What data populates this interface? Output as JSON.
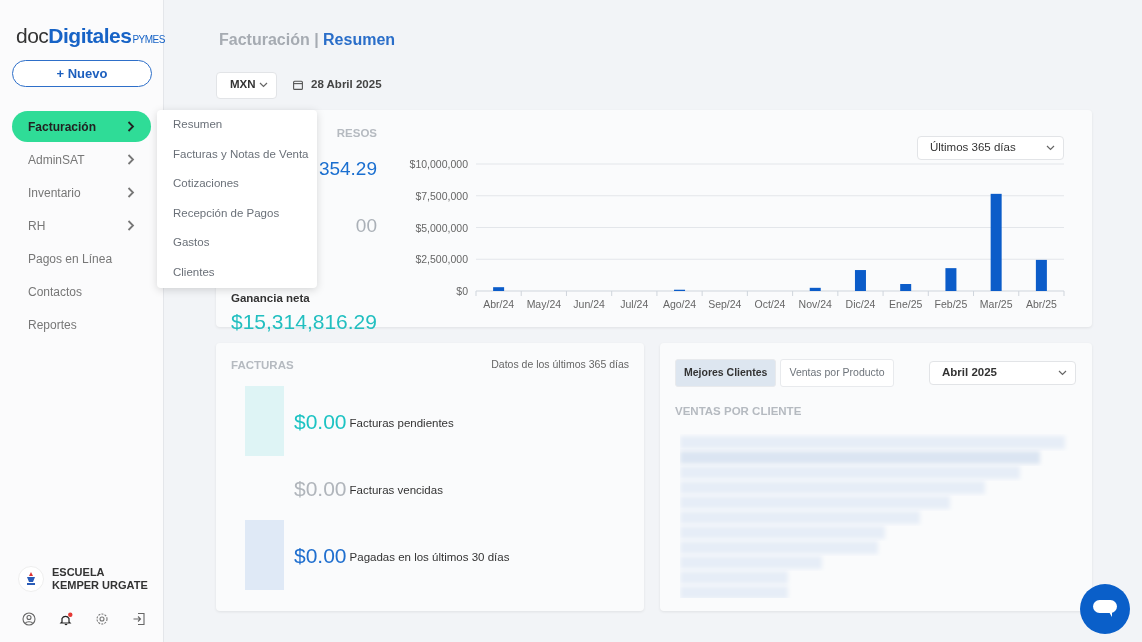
{
  "logo": {
    "prefix": "doc",
    "main": "Digitales",
    "suffix": "PYMES"
  },
  "new_button": {
    "icon": "+",
    "label": "Nuevo"
  },
  "nav": [
    {
      "label": "Facturación",
      "selected": true,
      "has_submenu": true
    },
    {
      "label": "AdminSAT",
      "selected": false,
      "has_submenu": true
    },
    {
      "label": "Inventario",
      "selected": false,
      "has_submenu": true
    },
    {
      "label": "RH",
      "selected": false,
      "has_submenu": true
    },
    {
      "label": "Pagos en Línea",
      "selected": false,
      "has_submenu": false
    },
    {
      "label": "Contactos",
      "selected": false,
      "has_submenu": false
    },
    {
      "label": "Reportes",
      "selected": false,
      "has_submenu": false
    }
  ],
  "submenu": [
    "Resumen",
    "Facturas y Notas de Venta",
    "Cotizaciones",
    "Recepción de Pagos",
    "Gastos",
    "Clientes"
  ],
  "account": {
    "name": "ESCUELA KEMPER URGATE",
    "has_notification": true
  },
  "breadcrumb": {
    "section": "Facturación",
    "separator": "|",
    "page": "Resumen"
  },
  "currency": "MXN",
  "date": "28 Abril 2025",
  "income_card": {
    "title": "RESOS",
    "range": "Últimos 365 días",
    "stats": [
      {
        "kind": "fragment",
        "value": "354.29",
        "color": "#1a6fd0"
      },
      {
        "kind": "fragment",
        "value": "00",
        "color": "#aab0b7"
      },
      {
        "kind": "labeled",
        "label": "Ganancia neta",
        "value": "$15,314,816.29",
        "color": "#22bfc0"
      }
    ],
    "chart_data": {
      "type": "bar",
      "categories": [
        "Abr/24",
        "May/24",
        "Jun/24",
        "Jul/24",
        "Ago/24",
        "Sep/24",
        "Oct/24",
        "Nov/24",
        "Dic/24",
        "Ene/25",
        "Feb/25",
        "Mar/25",
        "Abr/25"
      ],
      "grid": true,
      "series": [
        {
          "color": "#0b5cc9",
          "values": [
            300000,
            0,
            0,
            0,
            100000,
            0,
            0,
            250000,
            1650000,
            550000,
            1800000,
            7650000,
            2450000
          ]
        }
      ],
      "ylim": [
        0,
        10000000
      ],
      "yticks": [
        {
          "value": 0,
          "label": "$0"
        },
        {
          "value": 2500000,
          "label": "$2,500,000"
        },
        {
          "value": 5000000,
          "label": "$5,000,000"
        },
        {
          "value": 7500000,
          "label": "$7,500,000"
        },
        {
          "value": 10000000,
          "label": "$10,000,000"
        }
      ]
    }
  },
  "invoices_card": {
    "title": "FACTURAS",
    "note": "Datos de los últimos 365 días",
    "items": [
      {
        "amount": "$0.00",
        "label": "Facturas pendientes",
        "color": "#1cc3c3",
        "has_block": true
      },
      {
        "amount": "$0.00",
        "label": "Facturas vencidas",
        "color": "#b0b5bb",
        "has_block": false
      },
      {
        "amount": "$0.00",
        "label": "Pagadas en los últimos 30 días",
        "color": "#1f6fcf",
        "has_block": true
      }
    ]
  },
  "clients_card": {
    "tabs": [
      {
        "label": "Mejores Clientes",
        "selected": true
      },
      {
        "label": "Ventas por Producto",
        "selected": false
      }
    ],
    "month": "Abril 2025",
    "subtitle": "VENTAS POR CLIENTE"
  }
}
